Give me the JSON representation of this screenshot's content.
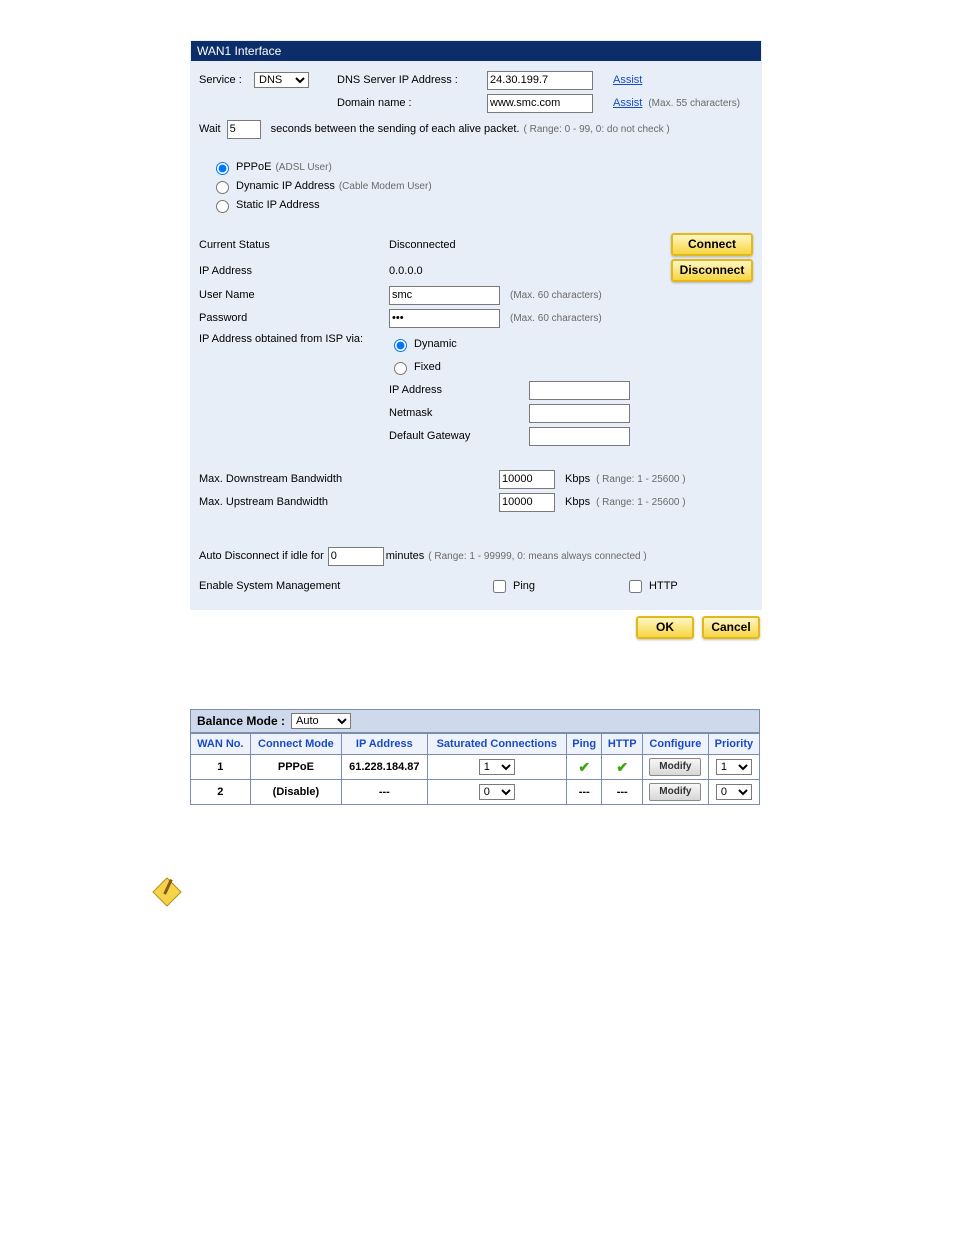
{
  "title": "WAN1 Interface",
  "service": {
    "label": "Service :",
    "value": "DNS"
  },
  "dns": {
    "label": "DNS Server IP Address :",
    "value": "24.30.199.7",
    "assist": "Assist"
  },
  "domain": {
    "label": "Domain name :",
    "value": "www.smc.com",
    "assist": "Assist",
    "hint": "(Max. 55 characters)"
  },
  "wait": {
    "label_pre": "Wait",
    "value": "5",
    "label_post": "seconds between the sending of each alive packet.",
    "hint": "( Range: 0 - 99, 0: do not check )"
  },
  "conn": {
    "pppoe": "PPPoE",
    "pppoe_hint": "(ADSL User)",
    "dynip": "Dynamic IP Address",
    "dynip_hint": "(Cable Modem User)",
    "static": "Static IP Address"
  },
  "status": {
    "label": "Current Status",
    "value": "Disconnected",
    "connect": "Connect",
    "disconnect": "Disconnect"
  },
  "ip": {
    "label": "IP Address",
    "value": "0.0.0.0"
  },
  "user": {
    "label": "User Name",
    "value": "smc",
    "hint": "(Max. 60 characters)"
  },
  "pass": {
    "label": "Password",
    "value": "•••",
    "hint": "(Max. 60 characters)"
  },
  "ispvia": {
    "label": "IP Address obtained from ISP via:",
    "dynamic": "Dynamic",
    "fixed": "Fixed",
    "ipaddr": "IP Address",
    "netmask": "Netmask",
    "gw": "Default Gateway"
  },
  "down": {
    "label": "Max. Downstream Bandwidth",
    "value": "10000",
    "unit": "Kbps",
    "hint": "( Range: 1 - 25600 )"
  },
  "up": {
    "label": "Max. Upstream Bandwidth",
    "value": "10000",
    "unit": "Kbps",
    "hint": "( Range: 1 - 25600 )"
  },
  "idle": {
    "label_pre": "Auto Disconnect if idle for",
    "value": "0",
    "label_post": "minutes",
    "hint": "( Range: 1 - 99999, 0: means always connected )"
  },
  "sys": {
    "label": "Enable System Management",
    "ping": "Ping",
    "http": "HTTP"
  },
  "buttons": {
    "ok": "OK",
    "cancel": "Cancel"
  },
  "balance": {
    "label": "Balance Mode :",
    "value": "Auto",
    "headers": {
      "wan": "WAN No.",
      "mode": "Connect Mode",
      "ip": "IP Address",
      "sat": "Saturated Connections",
      "ping": "Ping",
      "http": "HTTP",
      "cfg": "Configure",
      "prio": "Priority"
    },
    "rows": [
      {
        "wan": "1",
        "mode": "PPPoE",
        "ip": "61.228.184.87",
        "sat": "1",
        "ping": "✔",
        "http": "✔",
        "cfg": "Modify",
        "prio": "1"
      },
      {
        "wan": "2",
        "mode": "(Disable)",
        "ip": "---",
        "sat": "0",
        "ping": "---",
        "http": "---",
        "cfg": "Modify",
        "prio": "0"
      }
    ]
  }
}
